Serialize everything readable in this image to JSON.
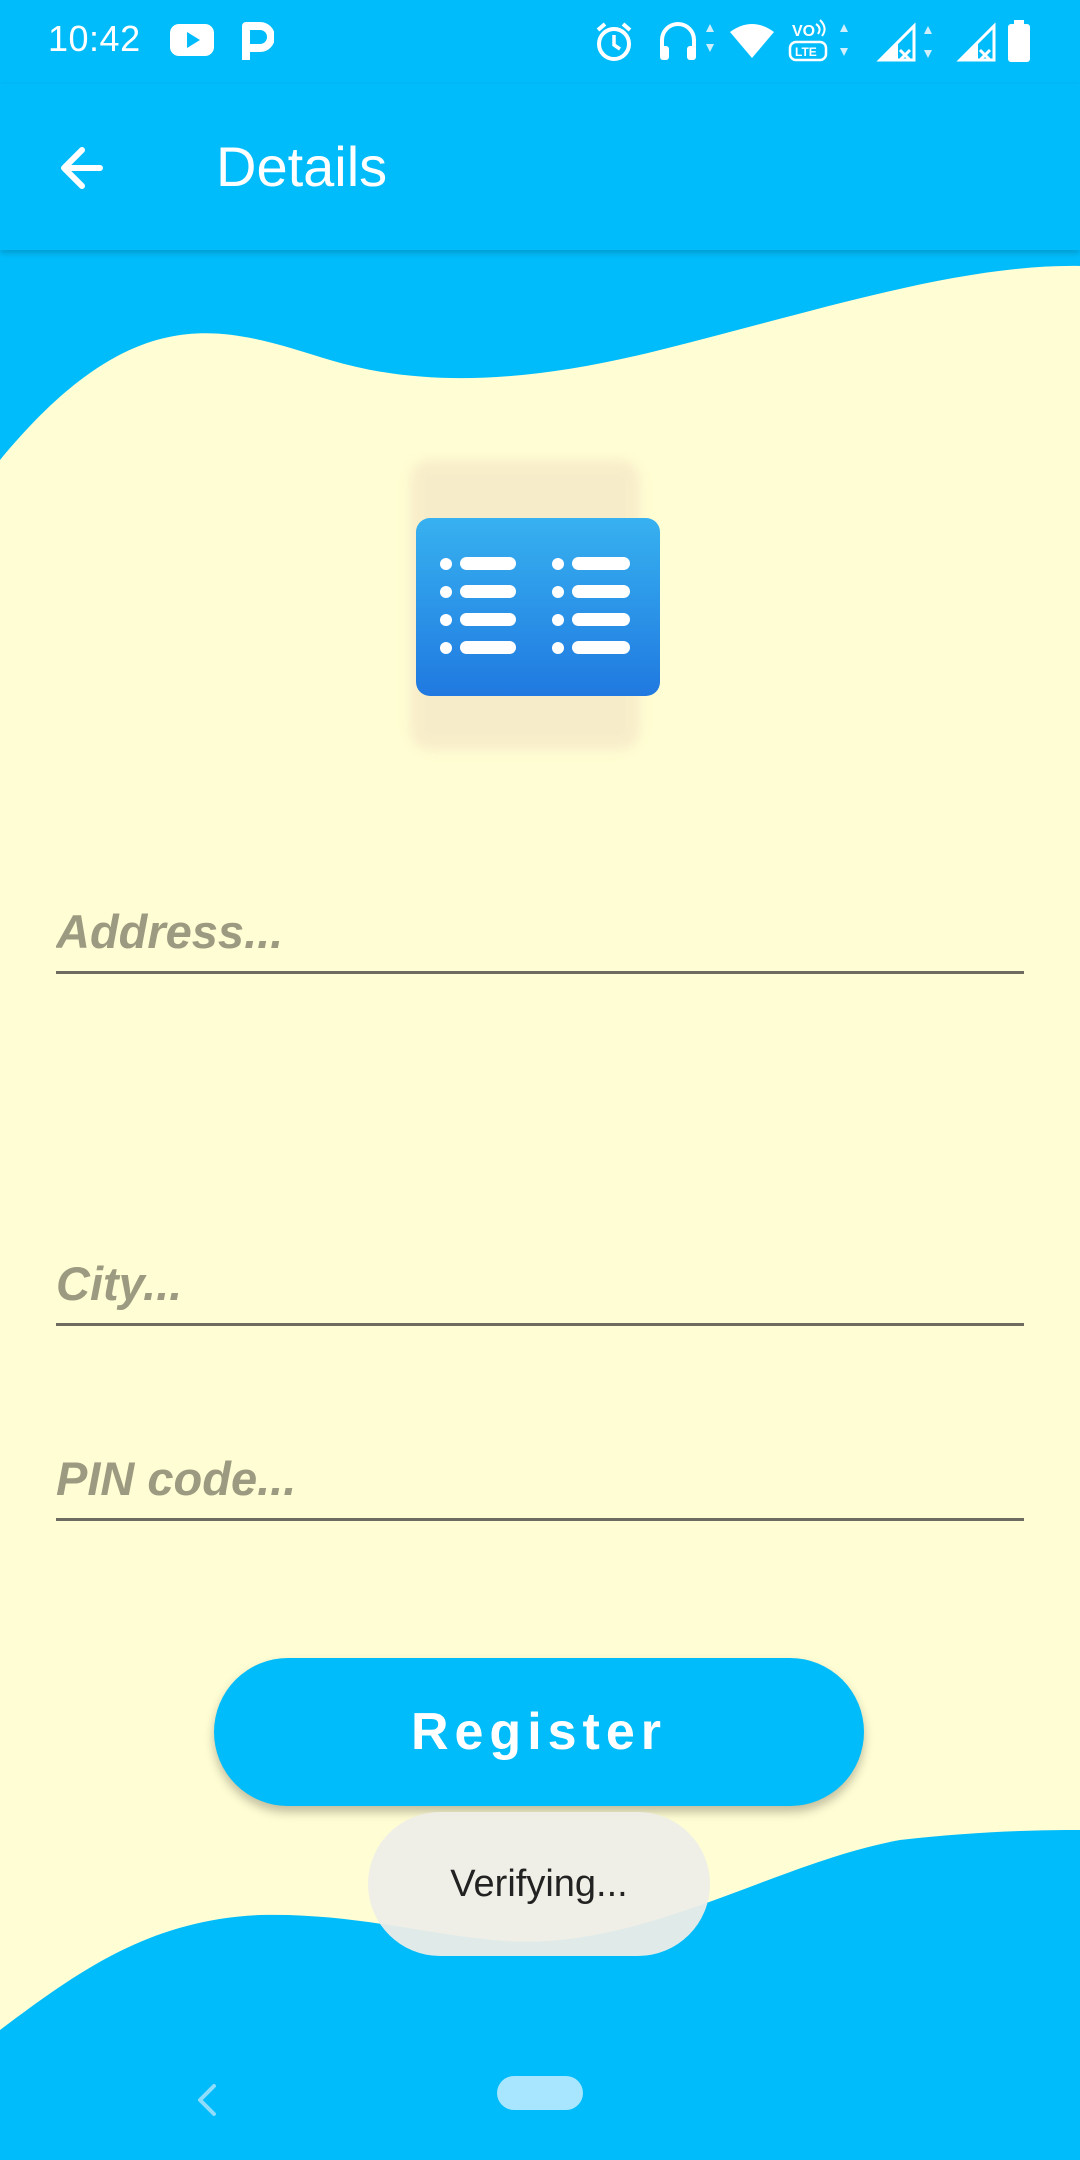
{
  "status_bar": {
    "time": "10:42",
    "icons": [
      "youtube-icon",
      "p-app-icon",
      "alarm-icon",
      "headphones-icon",
      "wifi-icon",
      "volte-icon",
      "signal-icon",
      "signal-icon",
      "battery-icon"
    ],
    "volte_text": "VO LTE"
  },
  "app_bar": {
    "title": "Details",
    "back_icon": "arrow-left-icon"
  },
  "logo": {
    "icon": "list-document-icon"
  },
  "form": {
    "address_placeholder": "Address...",
    "address_value": "",
    "city_placeholder": "City...",
    "city_value": "",
    "pin_placeholder": "PIN code...",
    "pin_value": "",
    "register_label": "Register"
  },
  "toast": {
    "text": "Verifying..."
  },
  "nav_bar": {
    "back_icon": "chevron-left-icon",
    "home_icon": "home-pill-icon"
  },
  "colors": {
    "primary": "#00bcfb",
    "background": "#fffdd3",
    "input_text": "#9c9a80",
    "underline": "#6e6b60",
    "icon_blue": "#2b8fe6"
  }
}
